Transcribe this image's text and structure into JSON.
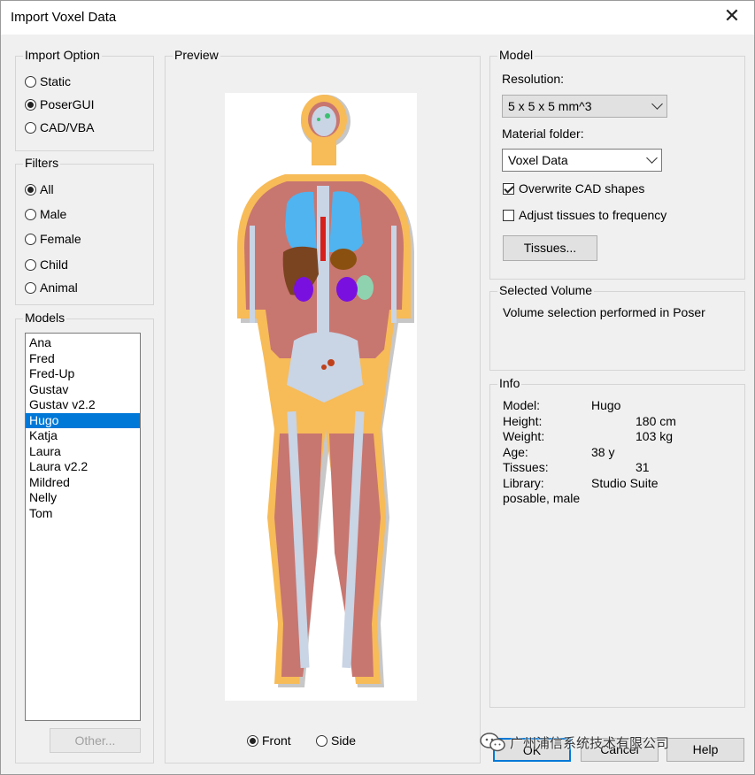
{
  "window": {
    "title": "Import Voxel Data"
  },
  "import_option": {
    "label": "Import Option",
    "options": [
      "Static",
      "PoserGUI",
      "CAD/VBA"
    ],
    "selected": "PoserGUI"
  },
  "filters": {
    "label": "Filters",
    "options": [
      "All",
      "Male",
      "Female",
      "Child",
      "Animal"
    ],
    "selected": "All"
  },
  "models": {
    "label": "Models",
    "items": [
      "Ana",
      "Fred",
      "Fred-Up",
      "Gustav",
      "Gustav v2.2",
      "Hugo",
      "Katja",
      "Laura",
      "Laura v2.2",
      "Mildred",
      "Nelly",
      "Tom"
    ],
    "selected": "Hugo",
    "other_button": "Other..."
  },
  "preview": {
    "label": "Preview",
    "views": [
      "Front",
      "Side"
    ],
    "selected_view": "Front"
  },
  "model": {
    "label": "Model",
    "resolution_label": "Resolution:",
    "resolution_value": "5 x 5 x 5 mm^3",
    "material_label": "Material folder:",
    "material_value": "Voxel Data",
    "overwrite_label": "Overwrite CAD shapes",
    "overwrite_checked": true,
    "adjust_label": "Adjust tissues to frequency",
    "adjust_checked": false,
    "tissues_button": "Tissues..."
  },
  "selected_volume": {
    "label": "Selected Volume",
    "text": "Volume selection performed in Poser"
  },
  "info": {
    "label": "Info",
    "rows": [
      {
        "key": "Model:",
        "value": "Hugo"
      },
      {
        "key": "Height:",
        "value": "180 cm"
      },
      {
        "key": "Weight:",
        "value": "103 kg"
      },
      {
        "key": "Age:",
        "value": "38 y"
      },
      {
        "key": "Tissues:",
        "value": "31"
      },
      {
        "key": "Library:",
        "value": "Studio Suite"
      }
    ],
    "extra": "posable, male"
  },
  "buttons": {
    "ok": "OK",
    "cancel": "Cancel",
    "help": "Help"
  },
  "watermark": "广州浦信系统技术有限公司",
  "colors": {
    "selection": "#0078d7",
    "fat": "#f7bb58",
    "muscle": "#c87670",
    "bone": "#c9d4e4",
    "lung": "#4fb4f0",
    "liver": "#7a4420",
    "kidney": "#7a10e0"
  }
}
